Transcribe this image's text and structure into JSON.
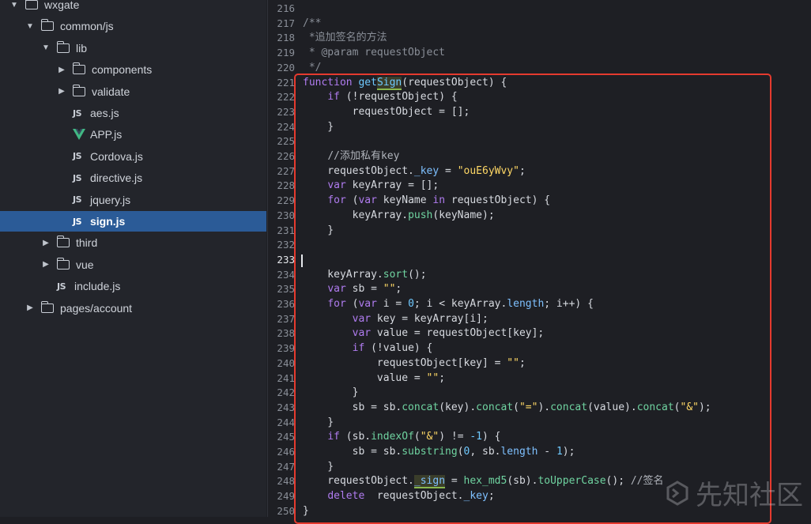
{
  "sidebar": {
    "tree": [
      {
        "label": "wxgate",
        "type": "folder",
        "expanded": true,
        "indent": 0
      },
      {
        "label": "common/js",
        "type": "folder",
        "expanded": true,
        "indent": 1
      },
      {
        "label": "lib",
        "type": "folder",
        "expanded": true,
        "indent": 2
      },
      {
        "label": "components",
        "type": "folder",
        "expanded": false,
        "indent": 3
      },
      {
        "label": "validate",
        "type": "folder",
        "expanded": false,
        "indent": 3
      },
      {
        "label": "aes.js",
        "type": "js",
        "indent": 3
      },
      {
        "label": "APP.js",
        "type": "vue",
        "indent": 3
      },
      {
        "label": "Cordova.js",
        "type": "js",
        "indent": 3
      },
      {
        "label": "directive.js",
        "type": "js",
        "indent": 3
      },
      {
        "label": "jquery.js",
        "type": "js",
        "indent": 3
      },
      {
        "label": "sign.js",
        "type": "js",
        "indent": 3,
        "selected": true
      },
      {
        "label": "third",
        "type": "folder",
        "expanded": false,
        "indent": 2
      },
      {
        "label": "vue",
        "type": "folder",
        "expanded": false,
        "indent": 2
      },
      {
        "label": "include.js",
        "type": "js",
        "indent": 2
      },
      {
        "label": "pages/account",
        "type": "folder",
        "expanded": false,
        "indent": 1
      }
    ],
    "js_badge": "JS"
  },
  "editor": {
    "lines": [
      {
        "n": "216",
        "t": []
      },
      {
        "n": "217",
        "t": [
          [
            "c",
            "/**"
          ]
        ]
      },
      {
        "n": "218",
        "t": [
          [
            "c",
            " *追加签名的方法"
          ]
        ]
      },
      {
        "n": "219",
        "t": [
          [
            "c",
            " * @param requestObject"
          ]
        ]
      },
      {
        "n": "220",
        "t": [
          [
            "c",
            " */"
          ]
        ]
      },
      {
        "n": "221",
        "t": [
          [
            "k",
            "function "
          ],
          [
            "f",
            "get"
          ],
          [
            "h",
            "Sign"
          ],
          [
            "p",
            "(requestObject) {"
          ]
        ]
      },
      {
        "n": "222",
        "t": [
          [
            "p",
            "    "
          ],
          [
            "k",
            "if"
          ],
          [
            "p",
            " (!requestObject) {"
          ]
        ]
      },
      {
        "n": "223",
        "t": [
          [
            "p",
            "        requestObject = [];"
          ]
        ]
      },
      {
        "n": "224",
        "t": [
          [
            "p",
            "    }"
          ]
        ]
      },
      {
        "n": "225",
        "t": []
      },
      {
        "n": "226",
        "t": [
          [
            "p",
            "    "
          ],
          [
            "cc",
            "//添加私有key"
          ]
        ]
      },
      {
        "n": "227",
        "t": [
          [
            "p",
            "    requestObject."
          ],
          [
            "r",
            "_key"
          ],
          [
            "p",
            " = "
          ],
          [
            "s",
            "\"ouE6yWvy\""
          ],
          [
            "p",
            ";"
          ]
        ]
      },
      {
        "n": "228",
        "t": [
          [
            "p",
            "    "
          ],
          [
            "k",
            "var"
          ],
          [
            "p",
            " keyArray = [];"
          ]
        ]
      },
      {
        "n": "229",
        "t": [
          [
            "p",
            "    "
          ],
          [
            "k",
            "for"
          ],
          [
            "p",
            " ("
          ],
          [
            "k",
            "var"
          ],
          [
            "p",
            " keyName "
          ],
          [
            "k",
            "in"
          ],
          [
            "p",
            " requestObject) {"
          ]
        ]
      },
      {
        "n": "230",
        "t": [
          [
            "p",
            "        keyArray."
          ],
          [
            "m",
            "push"
          ],
          [
            "p",
            "(keyName);"
          ]
        ]
      },
      {
        "n": "231",
        "t": [
          [
            "p",
            "    }"
          ]
        ]
      },
      {
        "n": "232",
        "t": []
      },
      {
        "n": "233",
        "t": []
      },
      {
        "n": "234",
        "t": [
          [
            "p",
            "    keyArray."
          ],
          [
            "m",
            "sort"
          ],
          [
            "p",
            "();"
          ]
        ]
      },
      {
        "n": "235",
        "t": [
          [
            "p",
            "    "
          ],
          [
            "k",
            "var"
          ],
          [
            "p",
            " sb = "
          ],
          [
            "s",
            "\"\""
          ],
          [
            "p",
            ";"
          ]
        ]
      },
      {
        "n": "236",
        "t": [
          [
            "p",
            "    "
          ],
          [
            "k",
            "for"
          ],
          [
            "p",
            " ("
          ],
          [
            "k",
            "var"
          ],
          [
            "p",
            " i = "
          ],
          [
            "n",
            "0"
          ],
          [
            "p",
            "; i < keyArray."
          ],
          [
            "r",
            "length"
          ],
          [
            "p",
            "; i++) {"
          ]
        ]
      },
      {
        "n": "237",
        "t": [
          [
            "p",
            "        "
          ],
          [
            "k",
            "var"
          ],
          [
            "p",
            " key = keyArray[i];"
          ]
        ]
      },
      {
        "n": "238",
        "t": [
          [
            "p",
            "        "
          ],
          [
            "k",
            "var"
          ],
          [
            "p",
            " value = requestObject[key];"
          ]
        ]
      },
      {
        "n": "239",
        "t": [
          [
            "p",
            "        "
          ],
          [
            "k",
            "if"
          ],
          [
            "p",
            " (!value) {"
          ]
        ]
      },
      {
        "n": "240",
        "t": [
          [
            "p",
            "            requestObject[key] = "
          ],
          [
            "s",
            "\"\""
          ],
          [
            "p",
            ";"
          ]
        ]
      },
      {
        "n": "241",
        "t": [
          [
            "p",
            "            value = "
          ],
          [
            "s",
            "\"\""
          ],
          [
            "p",
            ";"
          ]
        ]
      },
      {
        "n": "242",
        "t": [
          [
            "p",
            "        }"
          ]
        ]
      },
      {
        "n": "243",
        "t": [
          [
            "p",
            "        sb = sb."
          ],
          [
            "m",
            "concat"
          ],
          [
            "p",
            "(key)."
          ],
          [
            "m",
            "concat"
          ],
          [
            "p",
            "("
          ],
          [
            "s",
            "\"=\""
          ],
          [
            "p",
            ")."
          ],
          [
            "m",
            "concat"
          ],
          [
            "p",
            "(value)."
          ],
          [
            "m",
            "concat"
          ],
          [
            "p",
            "("
          ],
          [
            "s",
            "\"&\""
          ],
          [
            "p",
            ");"
          ]
        ]
      },
      {
        "n": "244",
        "t": [
          [
            "p",
            "    }"
          ]
        ]
      },
      {
        "n": "245",
        "t": [
          [
            "p",
            "    "
          ],
          [
            "k",
            "if"
          ],
          [
            "p",
            " (sb."
          ],
          [
            "m",
            "indexOf"
          ],
          [
            "p",
            "("
          ],
          [
            "s",
            "\"&\""
          ],
          [
            "p",
            ") != "
          ],
          [
            "n",
            "-1"
          ],
          [
            "p",
            ") {"
          ]
        ]
      },
      {
        "n": "246",
        "t": [
          [
            "p",
            "        sb = sb."
          ],
          [
            "m",
            "substring"
          ],
          [
            "p",
            "("
          ],
          [
            "n",
            "0"
          ],
          [
            "p",
            ", sb."
          ],
          [
            "r",
            "length"
          ],
          [
            "p",
            " - "
          ],
          [
            "n",
            "1"
          ],
          [
            "p",
            ");"
          ]
        ]
      },
      {
        "n": "247",
        "t": [
          [
            "p",
            "    }"
          ]
        ]
      },
      {
        "n": "248",
        "t": [
          [
            "p",
            "    requestObject."
          ],
          [
            "rh",
            "_sign"
          ],
          [
            "p",
            " = "
          ],
          [
            "m",
            "hex_md5"
          ],
          [
            "p",
            "(sb)."
          ],
          [
            "m",
            "toUpperCase"
          ],
          [
            "p",
            "(); "
          ],
          [
            "cc",
            "//签名"
          ]
        ]
      },
      {
        "n": "249",
        "t": [
          [
            "p",
            "    "
          ],
          [
            "k",
            "delete"
          ],
          [
            "p",
            "  requestObject."
          ],
          [
            "r",
            "_key"
          ],
          [
            "p",
            ";"
          ]
        ]
      },
      {
        "n": "250",
        "t": [
          [
            "p",
            "}"
          ]
        ]
      }
    ],
    "cursor_line": "233"
  },
  "watermark": {
    "text": "先知社区"
  },
  "colors": {
    "highlight_frame": "#e53a2e",
    "selection": "#2b5b97"
  }
}
